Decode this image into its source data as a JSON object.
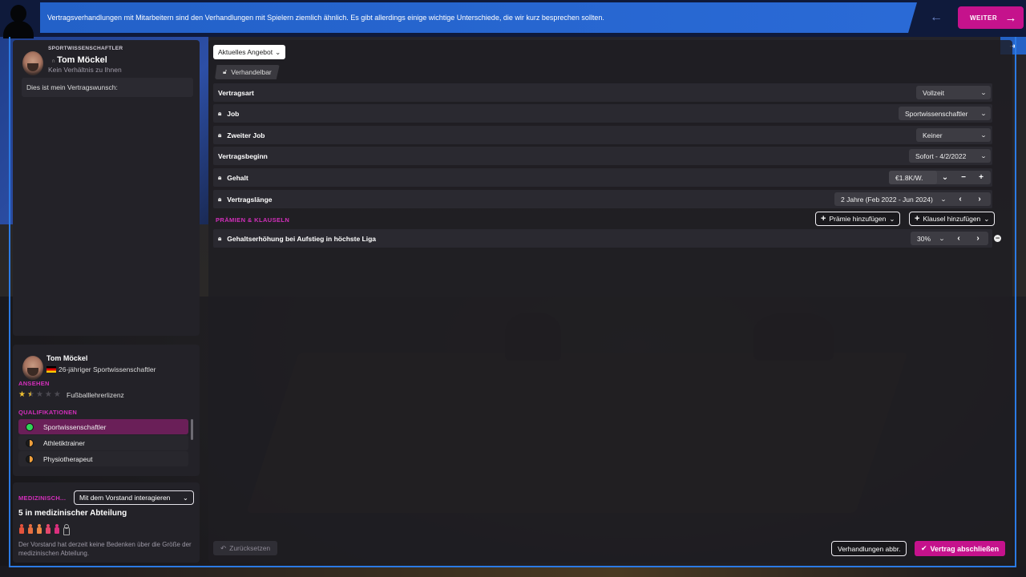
{
  "topbar": {
    "message": "Vertragsverhandlungen mit Mitarbeitern sind den Verhandlungen mit Spielern ziemlich ähnlich. Es gibt allerdings einige wichtige Unterschiede, die wir kurz besprechen sollten.",
    "next_label": "WEITER",
    "back_icon": "←",
    "next_icon": "→",
    "exit_icon": "⇥"
  },
  "person_panel": {
    "role": "SPORTWISSENSCHAFTLER",
    "name": "Tom Möckel",
    "relationship": "Kein Verhältnis zu Ihnen",
    "wish_text": "Dies ist mein Vertragswunsch:"
  },
  "profile": {
    "name": "Tom Möckel",
    "subtitle": "26-jähriger Sportwissenschaftler",
    "reputation_title": "ANSEHEN",
    "reputation_stars": 1.5,
    "licence": "Fußballlehrerlizenz",
    "qualifications_title": "QUALIFIKATIONEN",
    "qualifications": [
      {
        "label": "Sportwissenschaftler",
        "level": "full",
        "selected": true
      },
      {
        "label": "Athletiktrainer",
        "level": "half",
        "selected": false
      },
      {
        "label": "Physiotherapeut",
        "level": "half",
        "selected": false
      }
    ]
  },
  "medical": {
    "title": "MEDIZINISCH...",
    "dropdown": "Mit dem Vorstand interagieren",
    "rank": "5 in medizinischer Abteilung",
    "staff_filled": 5,
    "staff_total": 6,
    "note": "Der Vorstand hat derzeit keine Bedenken über die Größe der medizinischen Abteilung."
  },
  "offer": {
    "selector": "Aktuelles Angebot",
    "negotiable_tag": "Verhandelbar",
    "rows": {
      "contract_type": {
        "label": "Vertragsart",
        "value": "Vollzeit"
      },
      "job": {
        "label": "Job",
        "value": "Sportwissenschaftler"
      },
      "second_job": {
        "label": "Zweiter Job",
        "value": "Keiner"
      },
      "start": {
        "label": "Vertragsbeginn",
        "value": "Sofort - 4/2/2022"
      },
      "salary": {
        "label": "Gehalt",
        "value": "€1.8K/W."
      },
      "length": {
        "label": "Vertragslänge",
        "value": "2 Jahre (Feb 2022 - Jun 2024)"
      }
    },
    "bonus_section": "PRÄMIEN & KLAUSELN",
    "add_bonus": "Prämie hinzufügen",
    "add_clause": "Klausel hinzufügen",
    "clause": {
      "label": "Gehaltserhöhung bei Aufstieg in höchste Liga",
      "value": "30%"
    }
  },
  "footer": {
    "reset": "Zurücksetzen",
    "abort": "Verhandlungen abbr.",
    "finish": "Vertrag abschließen"
  },
  "colors": {
    "accent": "#c5128c",
    "blue": "#2a6ad6",
    "section": "#d42fbc"
  }
}
